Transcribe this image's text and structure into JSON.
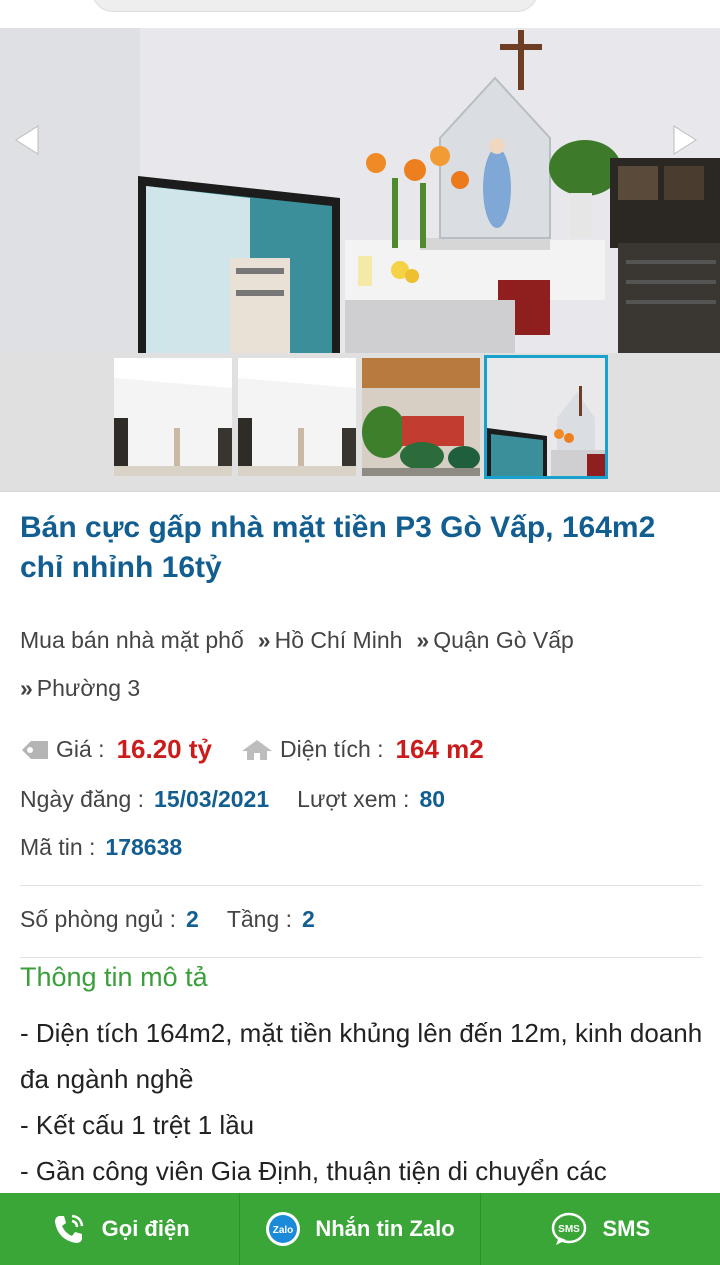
{
  "gallery": {
    "prev_icon": "chevron-left-icon",
    "next_icon": "chevron-right-icon",
    "thumb_count": 4,
    "active_thumb": 4
  },
  "listing": {
    "title": "Bán cực gấp nhà mặt tiền P3 Gò Vấp, 164m2 chỉ nhỉnh 16tỷ",
    "breadcrumbs": [
      "Mua bán nhà mặt phố",
      "Hồ Chí Minh",
      "Quận Gò Vấp",
      "Phường 3"
    ],
    "breadcrumb_separator": "»",
    "price_label": "Giá :",
    "price_value": "16.20 tỷ",
    "area_label": "Diện tích :",
    "area_value": "164 m2",
    "date_label": "Ngày đăng :",
    "date_value": "15/03/2021",
    "views_label": "Lượt xem :",
    "views_value": "80",
    "id_label": "Mã tin :",
    "id_value": "178638",
    "bedrooms_label": "Số phòng ngủ :",
    "bedrooms_value": "2",
    "floors_label": "Tầng :",
    "floors_value": "2"
  },
  "description": {
    "heading": "Thông tin mô tả",
    "lines": [
      "- Diện tích 164m2, mặt tiền khủng lên đến 12m, kinh doanh đa ngành nghề",
      "- Kết cấu 1 trệt 1 lầu",
      "- Gần công viên Gia Định, thuận tiện di chuyển các"
    ]
  },
  "actions": {
    "call_label": "Gọi điện",
    "zalo_label": "Nhắn tin Zalo",
    "zalo_badge": "Zalo",
    "sms_label": "SMS",
    "sms_badge": "SMS"
  },
  "colors": {
    "title_blue": "#125e91",
    "price_red": "#cc1b1b",
    "section_green": "#3a9f3a",
    "action_bar_green": "#3aa637",
    "thumb_active": "#1aa0cc"
  }
}
